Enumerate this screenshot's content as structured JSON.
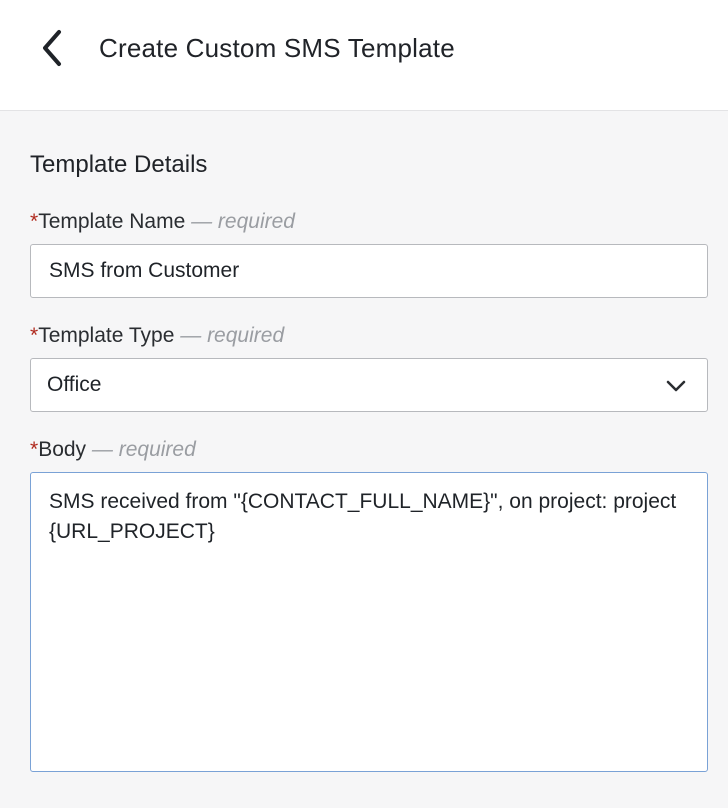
{
  "header": {
    "back_icon": "chevron-left-icon",
    "title": "Create Custom SMS Template"
  },
  "section": {
    "title": "Template Details"
  },
  "form": {
    "required_mark": "*",
    "required_hint": "— required",
    "template_name": {
      "label": "Template Name",
      "value": "SMS from Customer"
    },
    "template_type": {
      "label": "Template Type",
      "value": "Office",
      "dropdown_icon": "chevron-down-icon"
    },
    "body": {
      "label": "Body",
      "value": "SMS received from \"{CONTACT_FULL_NAME}\", on project: project {URL_PROJECT}"
    }
  },
  "colors": {
    "required_asterisk": "#b02a1e",
    "focused_border": "#7aa2d6",
    "background": "#f6f6f7"
  }
}
